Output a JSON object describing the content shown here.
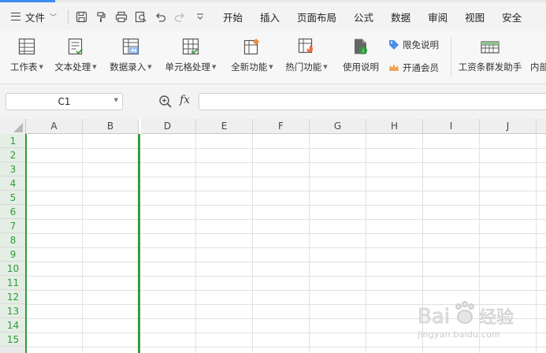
{
  "menu": {
    "file_label": "文件",
    "tabs": [
      "开始",
      "插入",
      "页面布局",
      "公式",
      "数据",
      "审阅",
      "视图",
      "安全"
    ]
  },
  "quick_access": [
    "save-icon",
    "format-painter-icon",
    "print-icon",
    "print-preview-icon",
    "undo-icon",
    "redo-icon",
    "more-dropdown-icon"
  ],
  "ribbon": {
    "worksheet": "工作表",
    "text_processing": "文本处理",
    "data_entry": "数据录入",
    "cell_processing": "单元格处理",
    "new_features": "全新功能",
    "hot_features": "热门功能",
    "usage_guide": "使用说明",
    "free_limit": "限免说明",
    "membership": "开通会员",
    "payroll": "工资条群发助手",
    "internal": "内部"
  },
  "formula_bar": {
    "name_box": "C1",
    "fx_label": "fx",
    "formula_value": ""
  },
  "sheet": {
    "columns": [
      "A",
      "B",
      "D",
      "E",
      "F",
      "G",
      "H",
      "I",
      "J"
    ],
    "rows": [
      "1",
      "2",
      "3",
      "4",
      "5",
      "6",
      "7",
      "8",
      "9",
      "10",
      "11",
      "12",
      "13",
      "14",
      "15"
    ],
    "hidden_column": "C"
  },
  "colors": {
    "accent_blue": "#3c8cf0",
    "selection_green": "#2f9e3b",
    "row_header_text": "#2e9a3a"
  },
  "watermark": {
    "brand": "Bai 经验",
    "url": "jingyan.baidu.com"
  }
}
